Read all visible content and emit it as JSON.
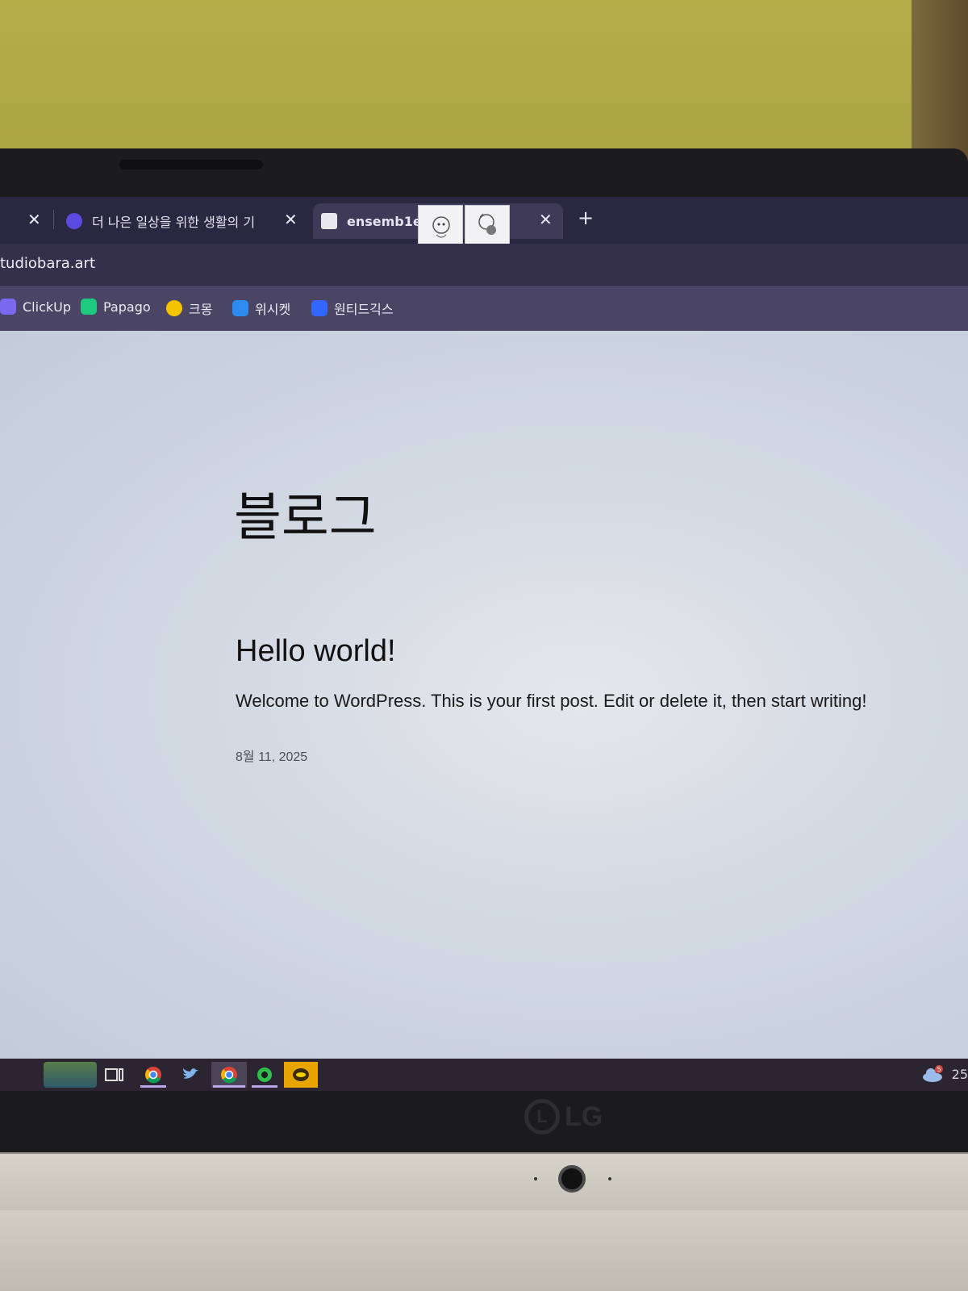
{
  "browser": {
    "tabs": [
      {
        "label": "",
        "active": false
      },
      {
        "label": "더 나은 일상을 위한 생활의 기",
        "active": false
      },
      {
        "label": "ensemb1e",
        "active": true
      }
    ],
    "close_glyph": "✕",
    "new_tab_glyph": "+",
    "url": "tudiobara.art",
    "bookmarks": [
      {
        "label": "ClickUp",
        "color": "#7b68ee"
      },
      {
        "label": "Papago",
        "color": "#1ec97f"
      },
      {
        "label": "크몽",
        "color": "#f5c400"
      },
      {
        "label": "위시켓",
        "color": "#2e8bf0"
      },
      {
        "label": "원티드긱스",
        "color": "#3366ff"
      }
    ]
  },
  "page": {
    "blog_title": "블로그",
    "post": {
      "title": "Hello world!",
      "excerpt": "Welcome to WordPress. This is your first post. Edit or delete it, then start writing!",
      "date": "8월 11, 2025"
    }
  },
  "taskbar": {
    "tray_time": "25",
    "weather_badge": "5"
  },
  "hardware": {
    "brand": "LG"
  }
}
